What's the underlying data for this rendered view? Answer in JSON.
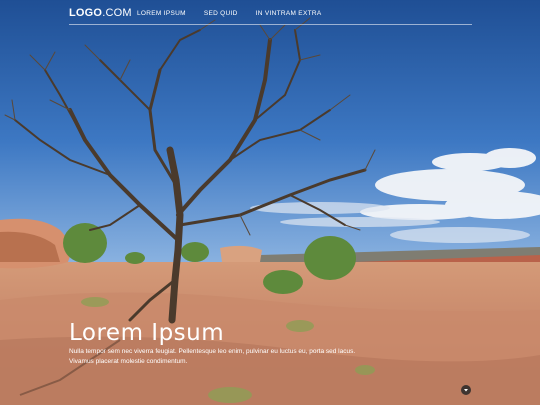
{
  "header": {
    "logo_strong": "LOGO",
    "logo_light": ".COM",
    "nav": [
      {
        "label": "LOREM IPSUM"
      },
      {
        "label": "SED QUID"
      },
      {
        "label": "IN VINTRAM EXTRA"
      }
    ]
  },
  "hero": {
    "title": "Lorem Ipsum",
    "line1": "Nulla tempor sem nec viverra feugiat. Pellentesque leo enim, pulvinar eu luctus eu, porta sed lacus.",
    "line2": "Vivamus placerat molestie condimentum."
  },
  "icons": {
    "scroll": "chevron-down-icon"
  }
}
